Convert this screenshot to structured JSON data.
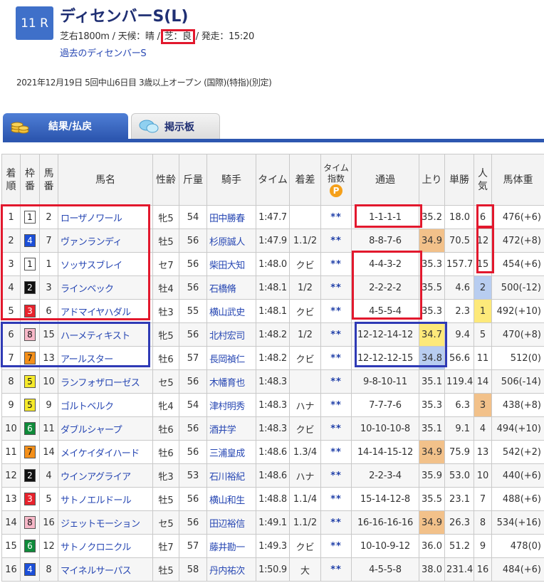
{
  "race": {
    "number": "11 R",
    "title": "ディセンバーS(L)",
    "course": "芝右1800m",
    "weather_label": "天候：晴",
    "track_label": "芝：良",
    "post_label": "発走：15:20",
    "past_link": "過去のディセンバーS",
    "info": "2021年12月19日 5回中山6日目 3歳以上オープン (国際)(特指)(別定)"
  },
  "tabs": {
    "results": "結果/払戻",
    "board": "掲示板"
  },
  "headers": {
    "rank": [
      "着",
      "順"
    ],
    "waku": [
      "枠",
      "番"
    ],
    "umaban": [
      "馬",
      "番"
    ],
    "name": "馬名",
    "sexage": "性齢",
    "weight": "斤量",
    "jockey": "騎手",
    "time": "タイム",
    "margin": "着差",
    "index": [
      "タイム",
      "指数"
    ],
    "index_icon": "P",
    "passing": "通過",
    "last3f": "上り",
    "odds": "単勝",
    "pop": [
      "人",
      "気"
    ],
    "body_weight": "馬体重"
  },
  "colors": {
    "w1": "#ffffff",
    "w2": "#111111",
    "w3": "#e8222c",
    "w4": "#1c4fd8",
    "w5": "#f6ea2a",
    "w6": "#0f8b3a",
    "w7": "#f5901a",
    "w8": "#f7b8c8"
  },
  "rows": [
    {
      "rank": "1",
      "waku": "1",
      "uma": "2",
      "name": "ローザノワール",
      "sa": "牝5",
      "kin": "54",
      "jockey": "田中勝春",
      "time": "1:47.7",
      "margin": "",
      "idx": "**",
      "pass": "1-1-1-1",
      "agari": "35.2",
      "odds": "18.0",
      "pop": "6",
      "bw": "476(+6)"
    },
    {
      "rank": "2",
      "waku": "4",
      "uma": "7",
      "name": "ヴァンランディ",
      "sa": "牡5",
      "kin": "56",
      "jockey": "杉原誠人",
      "time": "1:47.9",
      "margin": "1.1/2",
      "idx": "**",
      "pass": "8-8-7-6",
      "agari": "34.9",
      "odds": "70.5",
      "pop": "12",
      "bw": "472(+8)"
    },
    {
      "rank": "3",
      "waku": "1",
      "uma": "1",
      "name": "ソッサスブレイ",
      "sa": "セ7",
      "kin": "56",
      "jockey": "柴田大知",
      "time": "1:48.0",
      "margin": "クビ",
      "idx": "**",
      "pass": "4-4-3-2",
      "agari": "35.3",
      "odds": "157.7",
      "pop": "15",
      "bw": "454(+6)"
    },
    {
      "rank": "4",
      "waku": "2",
      "uma": "3",
      "name": "ラインベック",
      "sa": "牡4",
      "kin": "56",
      "jockey": "石橋脩",
      "time": "1:48.1",
      "margin": "1/2",
      "idx": "**",
      "pass": "2-2-2-2",
      "agari": "35.5",
      "odds": "4.6",
      "pop": "2",
      "bw": "500(-12)"
    },
    {
      "rank": "5",
      "waku": "3",
      "uma": "6",
      "name": "アドマイヤハダル",
      "sa": "牡3",
      "kin": "55",
      "jockey": "横山武史",
      "time": "1:48.1",
      "margin": "クビ",
      "idx": "**",
      "pass": "4-5-5-4",
      "agari": "35.3",
      "odds": "2.3",
      "pop": "1",
      "bw": "492(+10)"
    },
    {
      "rank": "6",
      "waku": "8",
      "uma": "15",
      "name": "ハーメティキスト",
      "sa": "牝5",
      "kin": "56",
      "jockey": "北村宏司",
      "time": "1:48.2",
      "margin": "1/2",
      "idx": "**",
      "pass": "12-12-14-12",
      "agari": "34.7",
      "odds": "9.4",
      "pop": "5",
      "bw": "470(+8)"
    },
    {
      "rank": "7",
      "waku": "7",
      "uma": "13",
      "name": "アールスター",
      "sa": "牡6",
      "kin": "57",
      "jockey": "長岡禎仁",
      "time": "1:48.2",
      "margin": "クビ",
      "idx": "**",
      "pass": "12-12-12-15",
      "agari": "34.8",
      "odds": "56.6",
      "pop": "11",
      "bw": "512(0)"
    },
    {
      "rank": "8",
      "waku": "5",
      "uma": "10",
      "name": "ランフォザローゼス",
      "sa": "セ5",
      "kin": "56",
      "jockey": "木幡育也",
      "time": "1:48.3",
      "margin": "",
      "idx": "**",
      "pass": "9-8-10-11",
      "agari": "35.1",
      "odds": "119.4",
      "pop": "14",
      "bw": "506(-14)"
    },
    {
      "rank": "9",
      "waku": "5",
      "uma": "9",
      "name": "ゴルトベルク",
      "sa": "牝4",
      "kin": "54",
      "jockey": "津村明秀",
      "time": "1:48.3",
      "margin": "ハナ",
      "idx": "**",
      "pass": "7-7-7-6",
      "agari": "35.3",
      "odds": "6.3",
      "pop": "3",
      "bw": "438(+8)"
    },
    {
      "rank": "10",
      "waku": "6",
      "uma": "11",
      "name": "ダブルシャープ",
      "sa": "牡6",
      "kin": "56",
      "jockey": "酒井学",
      "time": "1:48.3",
      "margin": "クビ",
      "idx": "**",
      "pass": "10-10-10-8",
      "agari": "35.1",
      "odds": "9.1",
      "pop": "4",
      "bw": "494(+10)"
    },
    {
      "rank": "11",
      "waku": "7",
      "uma": "14",
      "name": "メイケイダイハード",
      "sa": "牡6",
      "kin": "56",
      "jockey": "三浦皇成",
      "time": "1:48.6",
      "margin": "1.3/4",
      "idx": "**",
      "pass": "14-14-15-12",
      "agari": "34.9",
      "odds": "75.9",
      "pop": "13",
      "bw": "542(+2)"
    },
    {
      "rank": "12",
      "waku": "2",
      "uma": "4",
      "name": "ウインアグライア",
      "sa": "牝3",
      "kin": "53",
      "jockey": "石川裕紀",
      "time": "1:48.6",
      "margin": "ハナ",
      "idx": "**",
      "pass": "2-2-3-4",
      "agari": "35.9",
      "odds": "53.0",
      "pop": "10",
      "bw": "440(+6)"
    },
    {
      "rank": "13",
      "waku": "3",
      "uma": "5",
      "name": "サトノエルドール",
      "sa": "牡5",
      "kin": "56",
      "jockey": "横山和生",
      "time": "1:48.8",
      "margin": "1.1/4",
      "idx": "**",
      "pass": "15-14-12-8",
      "agari": "35.5",
      "odds": "23.1",
      "pop": "7",
      "bw": "488(+6)"
    },
    {
      "rank": "14",
      "waku": "8",
      "uma": "16",
      "name": "ジェットモーション",
      "sa": "セ5",
      "kin": "56",
      "jockey": "田辺裕信",
      "time": "1:49.1",
      "margin": "1.1/2",
      "idx": "**",
      "pass": "16-16-16-16",
      "agari": "34.9",
      "odds": "26.3",
      "pop": "8",
      "bw": "534(+16)"
    },
    {
      "rank": "15",
      "waku": "6",
      "uma": "12",
      "name": "サトノクロニクル",
      "sa": "牡7",
      "kin": "57",
      "jockey": "藤井勘一",
      "time": "1:49.3",
      "margin": "クビ",
      "idx": "**",
      "pass": "10-10-9-12",
      "agari": "36.0",
      "odds": "51.2",
      "pop": "9",
      "bw": "478(0)"
    },
    {
      "rank": "16",
      "waku": "4",
      "uma": "8",
      "name": "マイネルサーパス",
      "sa": "牡5",
      "kin": "58",
      "jockey": "丹内祐次",
      "time": "1:50.9",
      "margin": "大",
      "idx": "**",
      "pass": "4-5-5-8",
      "agari": "38.0",
      "odds": "231.4",
      "pop": "16",
      "bw": "484(+6)"
    }
  ],
  "highlights": {
    "agari_orange": [
      1,
      10,
      13
    ],
    "agari_yellow": [
      5
    ],
    "agari_blue": [
      6
    ],
    "pop_blue": [
      3
    ],
    "pop_yellow": [
      4
    ],
    "pop_orange": [
      8
    ]
  }
}
